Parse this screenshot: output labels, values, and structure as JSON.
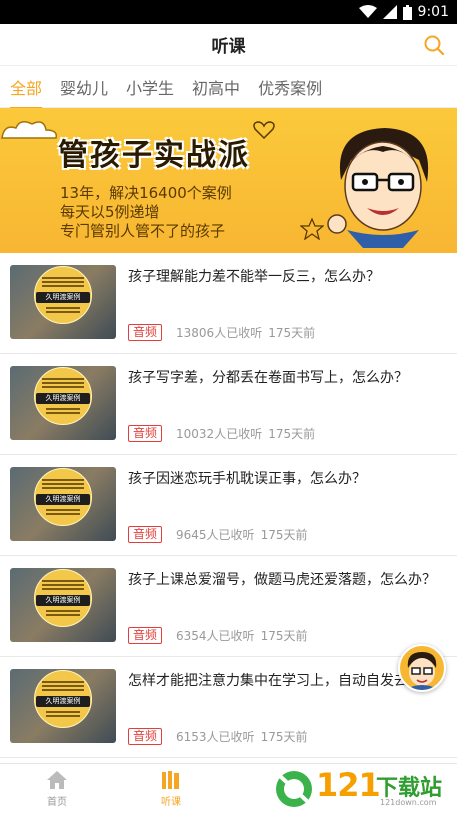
{
  "status_bar": {
    "time": "9:01"
  },
  "header": {
    "title": "听课"
  },
  "tabs": [
    {
      "label": "全部",
      "active": true
    },
    {
      "label": "婴幼儿",
      "active": false
    },
    {
      "label": "小学生",
      "active": false
    },
    {
      "label": "初高中",
      "active": false
    },
    {
      "label": "优秀案例",
      "active": false
    }
  ],
  "banner": {
    "headline": "管孩子实战派",
    "lines": [
      "13年，解决16400个案例",
      "每天以5例递增",
      "专门管别人管不了的孩子"
    ]
  },
  "thumbnail_text": "久明渡案例",
  "audio_badge": "音频",
  "items": [
    {
      "title": "孩子理解能力差不能举一反三，怎么办？",
      "listens": "13806人已收听",
      "age": "175天前"
    },
    {
      "title": "孩子写字差，分都丢在卷面书写上，怎么办？",
      "listens": "10032人已收听",
      "age": "175天前"
    },
    {
      "title": "孩子因迷恋玩手机耽误正事，怎么办？",
      "listens": "9645人已收听",
      "age": "175天前"
    },
    {
      "title": "孩子上课总爱溜号，做题马虎还爱落题，怎么办？",
      "listens": "6354人已收听",
      "age": "175天前"
    },
    {
      "title": "怎样才能把注意力集中在学习上，自动自发去",
      "listens": "6153人已收听",
      "age": "175天前"
    }
  ],
  "bottom_nav": [
    {
      "label": "首页",
      "icon": "home-icon",
      "active": false
    },
    {
      "label": "听课",
      "icon": "lessons-icon",
      "active": true
    },
    {
      "label": "",
      "icon": "",
      "active": false
    },
    {
      "label": "",
      "icon": "",
      "active": false
    }
  ],
  "watermark": {
    "number": "121",
    "text": "下载站",
    "url": "121down.com"
  },
  "colors": {
    "accent": "#f5a623",
    "badge": "#e0403c",
    "banner": "#f8b632"
  }
}
